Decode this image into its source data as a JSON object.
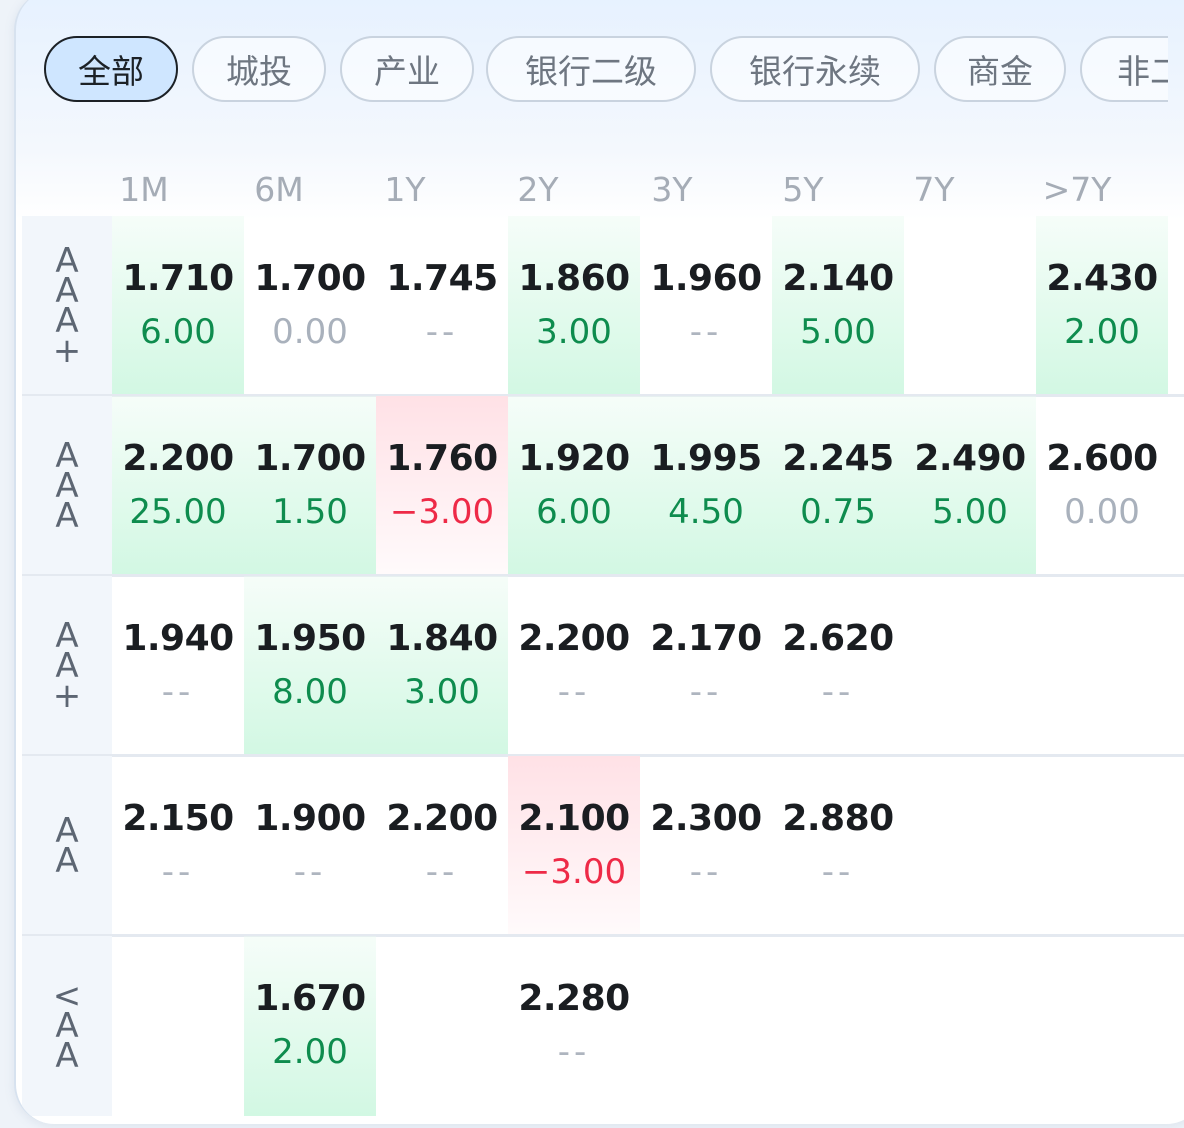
{
  "tabs": [
    {
      "label": "全部",
      "active": true
    },
    {
      "label": "城投",
      "active": false
    },
    {
      "label": "产业",
      "active": false
    },
    {
      "label": "银行二级",
      "active": false
    },
    {
      "label": "银行永续",
      "active": false
    },
    {
      "label": "商金",
      "active": false
    },
    {
      "label": "非二",
      "active": false
    }
  ],
  "tenors": [
    "1M",
    "6M",
    "1Y",
    "2Y",
    "3Y",
    "5Y",
    "7Y",
    ">7Y"
  ],
  "colors": {
    "up_bg": "#d2f8e3",
    "down_bg": "#ffe1e6",
    "pos_text": "#0e8c4e",
    "neg_text": "#ee2a47"
  },
  "rows": [
    {
      "rating": "AAA+",
      "cells": [
        {
          "yield": "1.710",
          "change": "6.00",
          "trend": "up"
        },
        {
          "yield": "1.700",
          "change": "0.00",
          "trend": "flat"
        },
        {
          "yield": "1.745",
          "change": "--",
          "trend": "none"
        },
        {
          "yield": "1.860",
          "change": "3.00",
          "trend": "up"
        },
        {
          "yield": "1.960",
          "change": "--",
          "trend": "none"
        },
        {
          "yield": "2.140",
          "change": "5.00",
          "trend": "up"
        },
        null,
        {
          "yield": "2.430",
          "change": "2.00",
          "trend": "up"
        }
      ]
    },
    {
      "rating": "AAA",
      "cells": [
        {
          "yield": "2.200",
          "change": "25.00",
          "trend": "up"
        },
        {
          "yield": "1.700",
          "change": "1.50",
          "trend": "up"
        },
        {
          "yield": "1.760",
          "change": "−3.00",
          "trend": "down"
        },
        {
          "yield": "1.920",
          "change": "6.00",
          "trend": "up"
        },
        {
          "yield": "1.995",
          "change": "4.50",
          "trend": "up"
        },
        {
          "yield": "2.245",
          "change": "0.75",
          "trend": "up"
        },
        {
          "yield": "2.490",
          "change": "5.00",
          "trend": "up"
        },
        {
          "yield": "2.600",
          "change": "0.00",
          "trend": "flat"
        }
      ]
    },
    {
      "rating": "AA+",
      "cells": [
        {
          "yield": "1.940",
          "change": "--",
          "trend": "none"
        },
        {
          "yield": "1.950",
          "change": "8.00",
          "trend": "up"
        },
        {
          "yield": "1.840",
          "change": "3.00",
          "trend": "up"
        },
        {
          "yield": "2.200",
          "change": "--",
          "trend": "none"
        },
        {
          "yield": "2.170",
          "change": "--",
          "trend": "none"
        },
        {
          "yield": "2.620",
          "change": "--",
          "trend": "none"
        },
        null,
        null
      ]
    },
    {
      "rating": "AA",
      "cells": [
        {
          "yield": "2.150",
          "change": "--",
          "trend": "none"
        },
        {
          "yield": "1.900",
          "change": "--",
          "trend": "none"
        },
        {
          "yield": "2.200",
          "change": "--",
          "trend": "none"
        },
        {
          "yield": "2.100",
          "change": "−3.00",
          "trend": "down"
        },
        {
          "yield": "2.300",
          "change": "--",
          "trend": "none"
        },
        {
          "yield": "2.880",
          "change": "--",
          "trend": "none"
        },
        null,
        null
      ]
    },
    {
      "rating": "<AA",
      "cells": [
        null,
        {
          "yield": "1.670",
          "change": "2.00",
          "trend": "up"
        },
        null,
        {
          "yield": "2.280",
          "change": "--",
          "trend": "none"
        },
        null,
        null,
        null,
        null
      ]
    }
  ]
}
